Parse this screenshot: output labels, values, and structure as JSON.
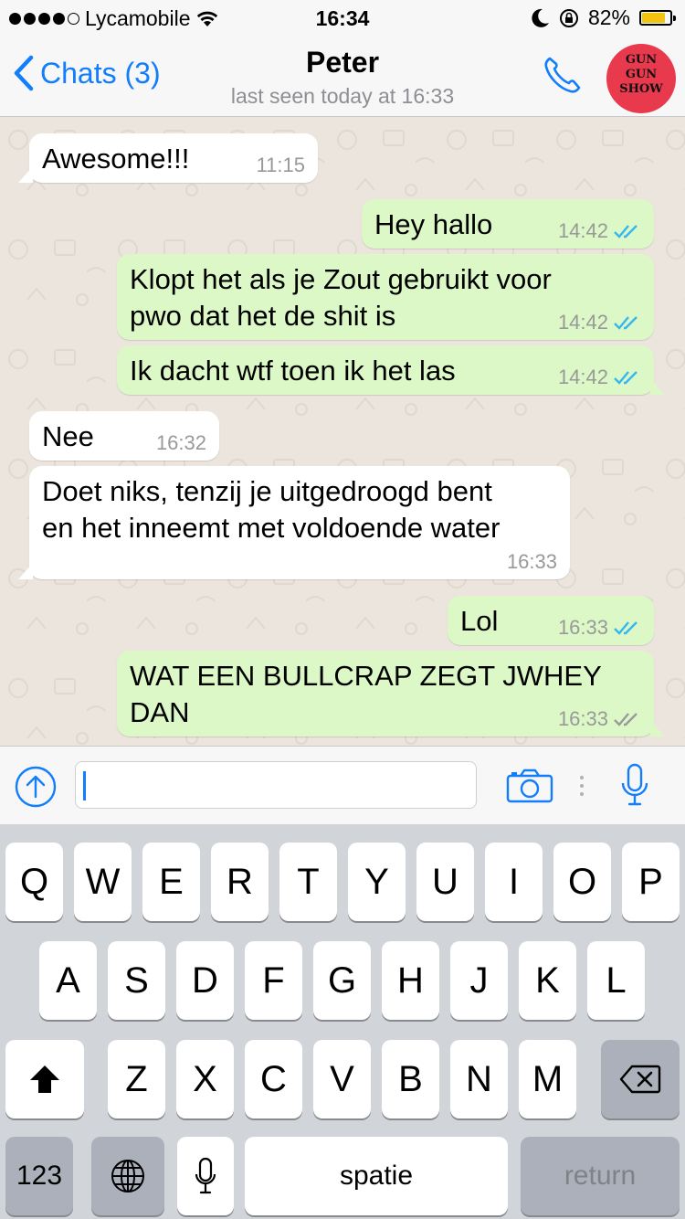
{
  "status": {
    "carrier": "Lycamobile",
    "time": "16:34",
    "battery": "82%",
    "battery_level": 0.82,
    "signal_bars": 4,
    "signal_total": 5
  },
  "header": {
    "back_label": "Chats (3)",
    "contact_name": "Peter",
    "last_seen": "last seen today at 16:33",
    "avatar_text": [
      "GUN",
      "GUN",
      "SHOW"
    ]
  },
  "messages": [
    {
      "dir": "in",
      "text": "Awesome!!!",
      "time": "11:15"
    },
    {
      "dir": "out",
      "text": "Hey hallo",
      "time": "14:42",
      "read": true
    },
    {
      "dir": "out",
      "text": "Klopt het als je Zout gebruikt voor\npwo dat het de shit is",
      "time": "14:42",
      "read": true
    },
    {
      "dir": "out",
      "text": "Ik dacht wtf toen ik het las",
      "time": "14:42",
      "read": true
    },
    {
      "dir": "in",
      "text": "Nee",
      "time": "16:32"
    },
    {
      "dir": "in",
      "text": "Doet niks, tenzij je uitgedroogd bent\nen het inneemt met voldoende water",
      "time": "16:33"
    },
    {
      "dir": "out",
      "text": "Lol",
      "time": "16:33",
      "read": true
    },
    {
      "dir": "out",
      "text": "WAT EEN BULLCRAP ZEGT JWHEY\nDAN",
      "time": "16:33",
      "read": false
    }
  ],
  "input": {
    "value": ""
  },
  "keyboard": {
    "row1": [
      "Q",
      "W",
      "E",
      "R",
      "T",
      "Y",
      "U",
      "I",
      "O",
      "P"
    ],
    "row2": [
      "A",
      "S",
      "D",
      "F",
      "G",
      "H",
      "J",
      "K",
      "L"
    ],
    "row3": [
      "Z",
      "X",
      "C",
      "V",
      "B",
      "N",
      "M"
    ],
    "numbers_label": "123",
    "space_label": "spatie",
    "return_label": "return"
  },
  "colors": {
    "accent": "#127efb",
    "outgoing_bubble": "#dcf8c6",
    "incoming_bubble": "#ffffff",
    "chat_background": "#ece5dd",
    "read_ticks": "#34b7f1",
    "battery": "#f3c40f",
    "avatar": "#e83a4c"
  },
  "icons": {
    "back": "chevron-left-icon",
    "call": "phone-icon",
    "share": "upload-arrow-icon",
    "camera": "camera-icon",
    "mic": "microphone-icon",
    "shift": "shift-arrow-icon",
    "delete": "backspace-icon",
    "globe": "globe-icon",
    "dictation": "microphone-icon"
  }
}
